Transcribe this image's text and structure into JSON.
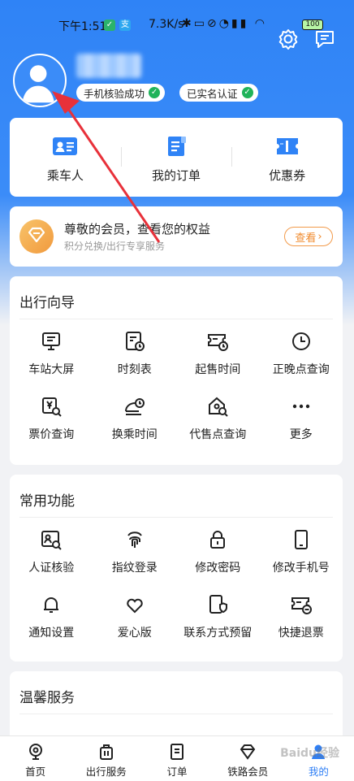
{
  "status_bar": {
    "time": "下午1:51",
    "speed": "7.3K/s",
    "battery": "100"
  },
  "header": {
    "settings_icon": "gear-icon",
    "message_icon": "message-icon",
    "badges": [
      {
        "label": "手机核验成功"
      },
      {
        "label": "已实名认证"
      }
    ]
  },
  "quick_actions": [
    {
      "label": "乘车人",
      "icon": "passenger-card-icon"
    },
    {
      "label": "我的订单",
      "icon": "order-doc-icon"
    },
    {
      "label": "优惠券",
      "icon": "coupon-icon"
    }
  ],
  "member": {
    "title": "尊敬的会员，查看您的权益",
    "subtitle": "积分兑换/出行专享服务",
    "button": "查看"
  },
  "travel_guide": {
    "title": "出行向导",
    "items": [
      {
        "label": "车站大屏",
        "icon": "station-screen-icon"
      },
      {
        "label": "时刻表",
        "icon": "timetable-icon"
      },
      {
        "label": "起售时间",
        "icon": "sale-time-icon"
      },
      {
        "label": "正晚点查询",
        "icon": "clock-icon"
      },
      {
        "label": "票价查询",
        "icon": "fare-search-icon"
      },
      {
        "label": "换乘时间",
        "icon": "transfer-time-icon"
      },
      {
        "label": "代售点查询",
        "icon": "agency-search-icon"
      },
      {
        "label": "更多",
        "icon": "more-icon"
      }
    ]
  },
  "common_functions": {
    "title": "常用功能",
    "items": [
      {
        "label": "人证核验",
        "icon": "id-verify-icon"
      },
      {
        "label": "指纹登录",
        "icon": "fingerprint-icon"
      },
      {
        "label": "修改密码",
        "icon": "lock-icon"
      },
      {
        "label": "修改手机号",
        "icon": "phone-icon"
      },
      {
        "label": "通知设置",
        "icon": "bell-icon"
      },
      {
        "label": "爱心版",
        "icon": "heart-icon"
      },
      {
        "label": "联系方式预留",
        "icon": "contact-shield-icon"
      },
      {
        "label": "快捷退票",
        "icon": "refund-ticket-icon"
      }
    ]
  },
  "warm_service": {
    "title": "温馨服务"
  },
  "bottom_nav": [
    {
      "label": "首页",
      "icon": "home-icon",
      "active": false
    },
    {
      "label": "出行服务",
      "icon": "luggage-icon",
      "active": false
    },
    {
      "label": "订单",
      "icon": "order-icon",
      "active": false
    },
    {
      "label": "铁路会员",
      "icon": "diamond-icon",
      "active": false
    },
    {
      "label": "我的",
      "icon": "profile-icon",
      "active": true
    }
  ],
  "watermark": "Baidu经验",
  "colors": {
    "primary": "#2f7ff5",
    "check_green": "#20b35a",
    "member_orange": "#f08a2c",
    "arrow_red": "#e8313a"
  }
}
